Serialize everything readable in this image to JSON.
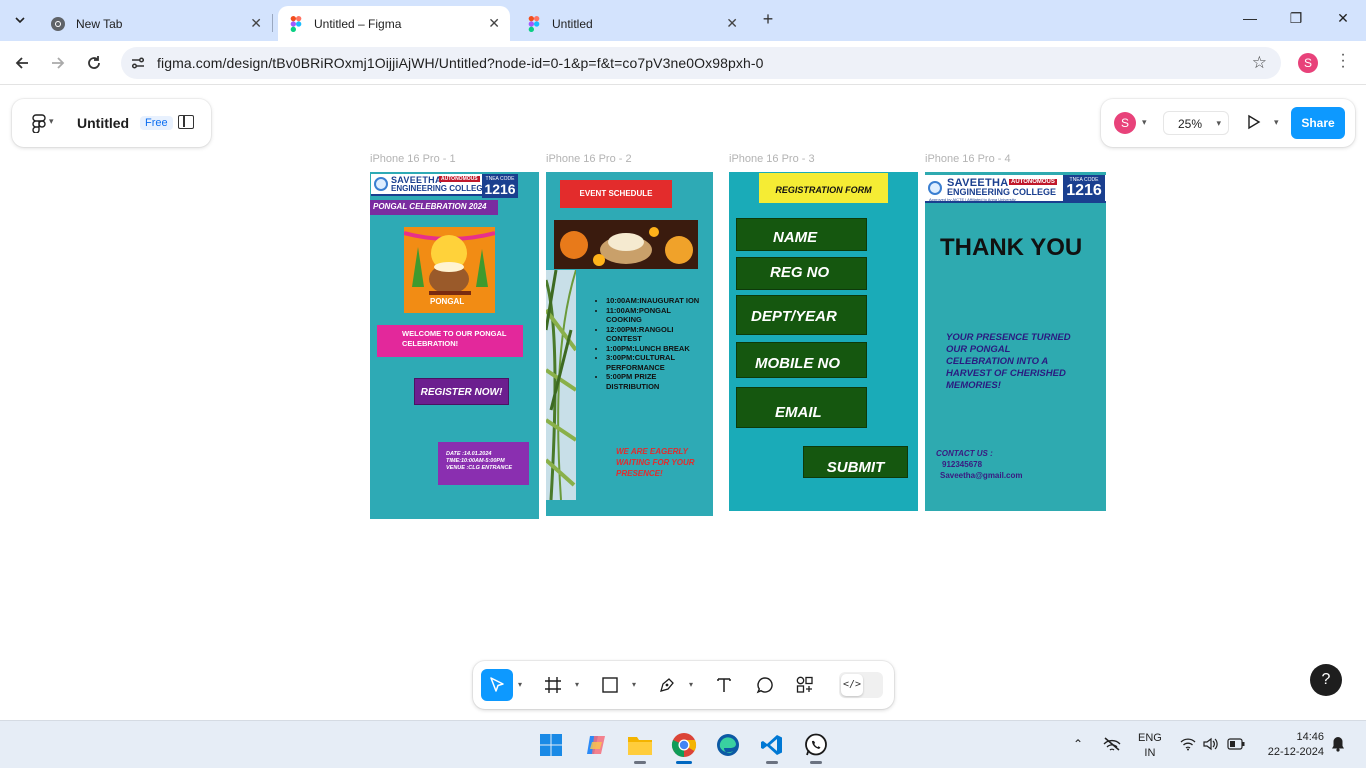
{
  "browser": {
    "tabs": [
      {
        "title": "New Tab",
        "icon": "chrome-icon"
      },
      {
        "title": "Untitled – Figma",
        "icon": "figma-icon",
        "active": true
      },
      {
        "title": "Untitled",
        "icon": "figma-icon"
      }
    ],
    "url": "figma.com/design/tBv0BRiROxmj1OijjiAjWH/Untitled?node-id=0-1&p=f&t=co7pV3ne0Ox98pxh-0",
    "profile_initial": "S"
  },
  "figma": {
    "file_name": "Untitled",
    "plan_badge": "Free",
    "user_initial": "S",
    "zoom": "25%",
    "share_label": "Share",
    "accent_color": "#0d99ff",
    "help_label": "?",
    "dev_mode_label": "</>",
    "frames": [
      {
        "label": "iPhone 16 Pro - 1",
        "college_name_line1": "SAVEETHA",
        "college_name_line2": "ENGINEERING COLLEGE",
        "autonomous": "AUTONOMOUS",
        "tnea_code_label": "TNEA CODE",
        "tnea_code": "1216",
        "banner": "PONGAL CELEBRATION 2024",
        "image_caption": "PONGAL",
        "welcome": "WELCOME TO OUR PONGAL CELEBRATION!",
        "register_button": "REGISTER NOW!",
        "date": "DATE :14.01.2024",
        "time": "TIME:10:00AM-5:00PM",
        "venue": "VENUE :CLG ENTRANCE"
      },
      {
        "label": "iPhone 16 Pro - 2",
        "header": "EVENT SCHEDULE",
        "schedule": [
          "10:00AM:INAUGURAT ION",
          "11:00AM:PONGAL COOKING",
          "12:00PM:RANGOLI CONTEST",
          "1:00PM:LUNCH BREAK",
          "3:00PM:CULTURAL PERFORMANCE",
          "5:00PM PRIZE DISTRIBUTION"
        ],
        "footer": "WE ARE EAGERLY WAITING FOR YOUR PRESENCE!"
      },
      {
        "label": "iPhone 16 Pro - 3",
        "header": "REGISTRATION FORM",
        "fields": [
          "NAME",
          "REG NO",
          "DEPT/YEAR",
          "MOBILE NO",
          "EMAIL"
        ],
        "submit": "SUBMIT"
      },
      {
        "label": "iPhone 16 Pro - 4",
        "college_name_line1": "SAVEETHA",
        "college_name_line2": "ENGINEERING COLLEGE",
        "autonomous": "AUTONOMOUS",
        "tnea_code_label": "TNEA CODE",
        "tnea_code": "1216",
        "approved": "Approved by AICTE | Affiliated to Anna University",
        "title": "THANK YOU",
        "message": "YOUR PRESENCE TURNED OUR PONGAL CELEBRATION INTO A HARVEST OF CHERISHED MEMORIES!",
        "contact_label": "CONTACT US :",
        "phone": "912345678",
        "email": "Saveetha@gmail.com"
      }
    ],
    "toolbar": [
      {
        "name": "move-tool",
        "icon": "cursor-icon",
        "selected": true
      },
      {
        "name": "frame-tool",
        "icon": "frame-icon"
      },
      {
        "name": "shape-tool",
        "icon": "rectangle-icon"
      },
      {
        "name": "pen-tool",
        "icon": "pen-icon"
      },
      {
        "name": "text-tool",
        "icon": "text-icon"
      },
      {
        "name": "comment-tool",
        "icon": "comment-icon"
      },
      {
        "name": "actions-tool",
        "icon": "actions-icon"
      }
    ]
  },
  "taskbar": {
    "apps": [
      "windows-start",
      "copilot",
      "file-explorer",
      "chrome",
      "edge",
      "vscode",
      "whatsapp"
    ],
    "lang_line1": "ENG",
    "lang_line2": "IN",
    "time": "14:46",
    "date": "22-12-2024"
  }
}
